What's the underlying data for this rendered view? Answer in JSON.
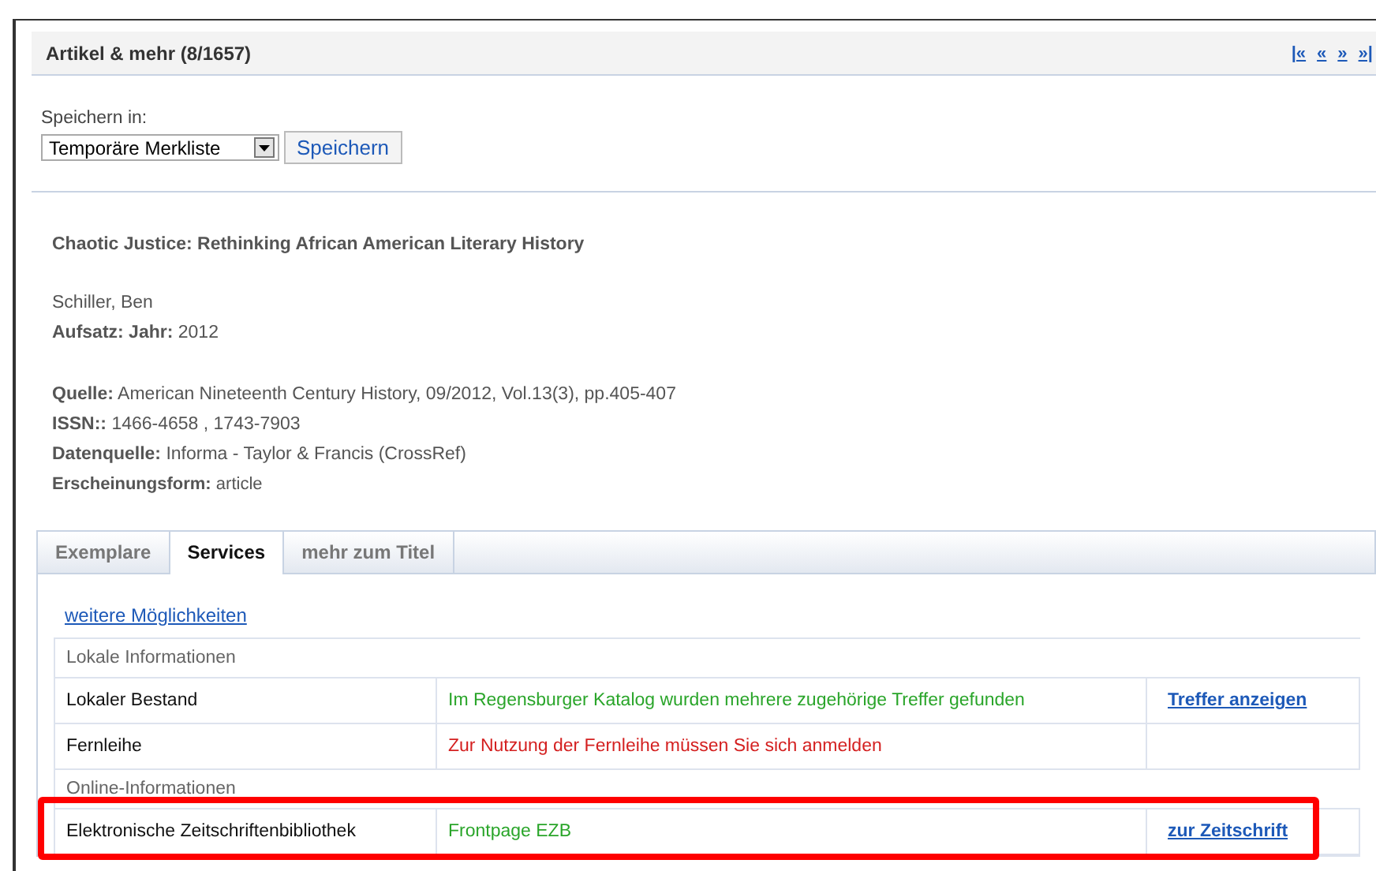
{
  "header": {
    "title": "Artikel & mehr (8/1657)",
    "nav": [
      "|«",
      "«",
      "»",
      "»|"
    ]
  },
  "save": {
    "label": "Speichern in:",
    "select_value": "Temporäre Merkliste",
    "button": "Speichern"
  },
  "record": {
    "title": "Chaotic Justice: Rethinking African American Literary History",
    "author": "Schiller, Ben",
    "fields_1": [
      {
        "label": "Aufsatz: Jahr:",
        "value": "2012"
      }
    ],
    "fields_2": [
      {
        "label": "Quelle:",
        "value": "American Nineteenth Century History, 09/2012, Vol.13(3), pp.405-407"
      },
      {
        "label": "ISSN::",
        "value": "1466-4658 , 1743-7903"
      },
      {
        "label": "Datenquelle:",
        "value": "Informa - Taylor & Francis (CrossRef)"
      },
      {
        "label": "Erscheinungsform:",
        "value": "article",
        "small": true
      }
    ]
  },
  "tabs": [
    {
      "label": "Exemplare",
      "selected": false
    },
    {
      "label": "Services",
      "selected": true
    },
    {
      "label": "mehr zum Titel",
      "selected": false
    }
  ],
  "more_link": "weitere Möglichkeiten",
  "rows": [
    {
      "kind": "section",
      "label": "Lokale Informationen"
    },
    {
      "kind": "item",
      "label": "Lokaler Bestand",
      "message": "Im Regensburger Katalog wurden mehrere zugehörige Treffer gefunden",
      "color": "#2aa52a",
      "action": "Treffer anzeigen",
      "highlighted": false
    },
    {
      "kind": "item",
      "label": "Fernleihe",
      "message": "Zur Nutzung der Fernleihe müssen Sie sich anmelden",
      "color": "#d42020",
      "highlighted": false
    },
    {
      "kind": "section",
      "label": "Online-Informationen"
    },
    {
      "kind": "item",
      "label": "Elektronische Zeitschriftenbibliothek",
      "message": "Frontpage EZB",
      "color": "#2aa52a",
      "action": "zur Zeitschrift",
      "highlighted": true
    }
  ]
}
